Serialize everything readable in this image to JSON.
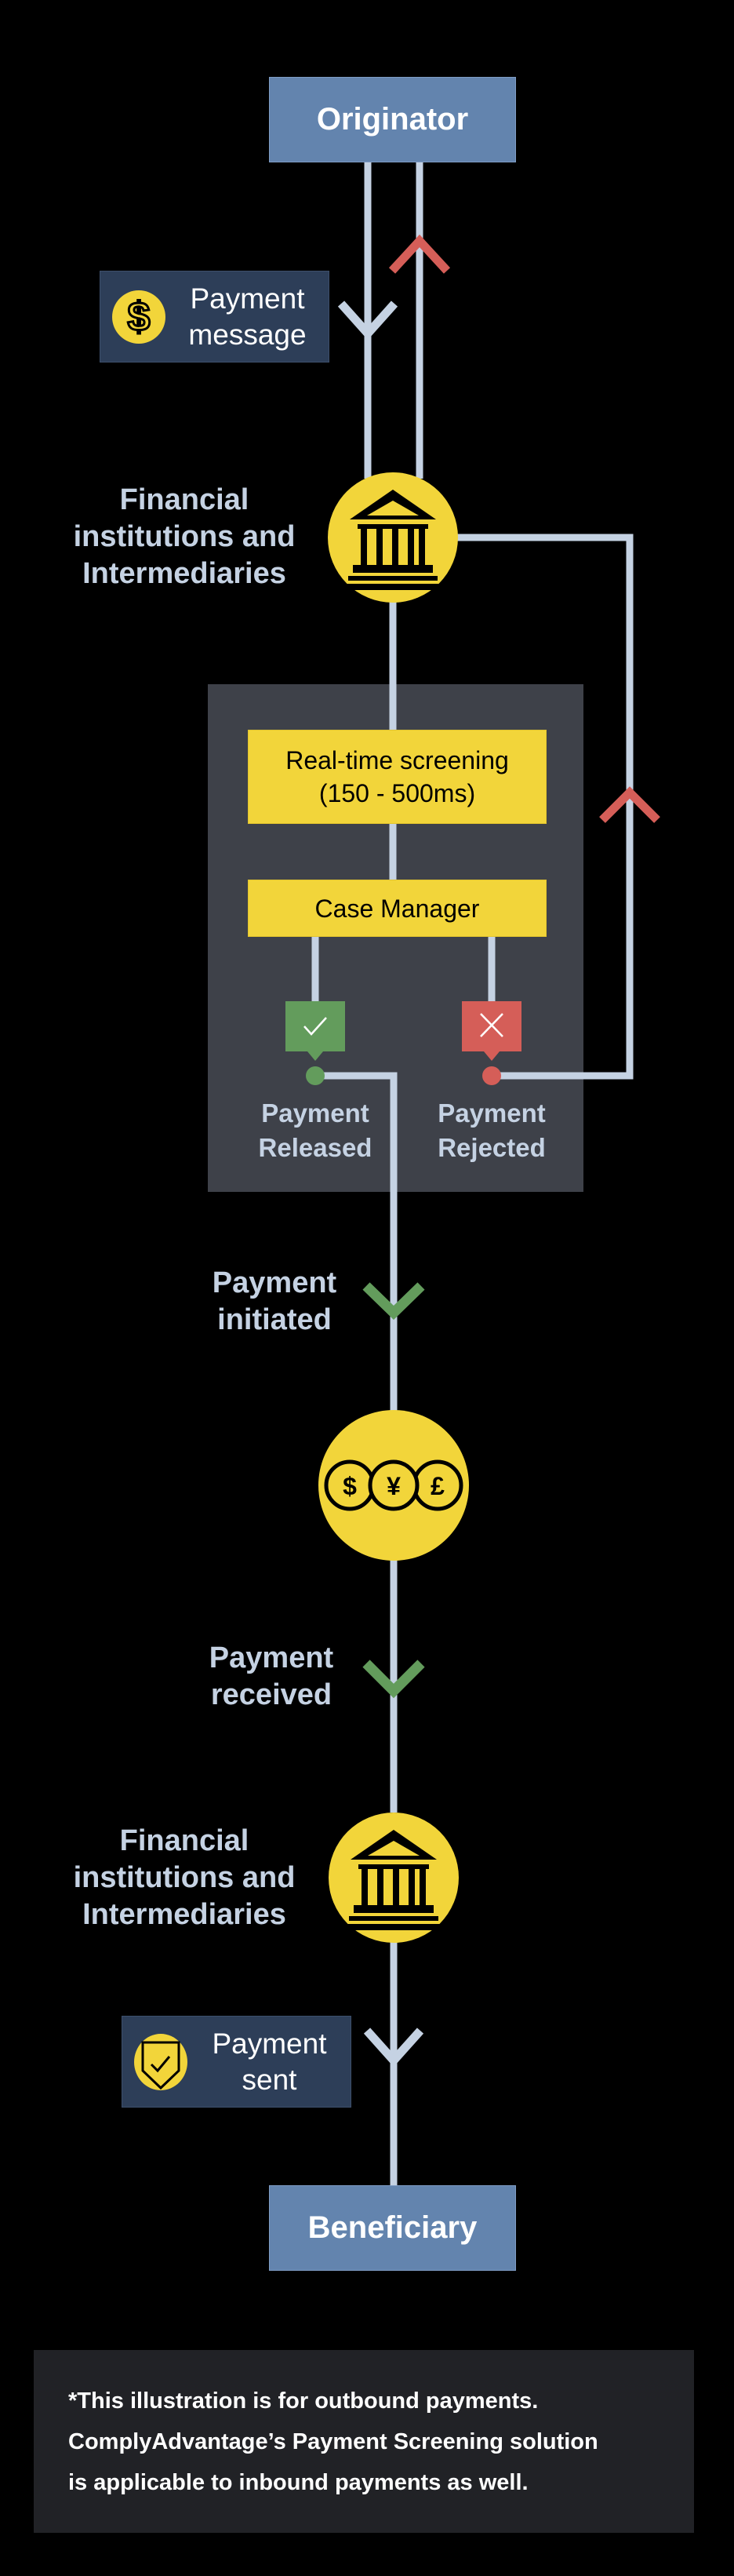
{
  "colors": {
    "background": "#000000",
    "node_blue": "#6384ae",
    "tag_navy": "#2d3e58",
    "line": "#c5d2e3",
    "accent_yellow": "#f2d53a",
    "panel_grey": "#3e4149",
    "approve_green": "#639c5c",
    "reject_red": "#d55e58",
    "footer_bg": "#212226"
  },
  "nodes": {
    "originator": "Originator",
    "beneficiary": "Beneficiary"
  },
  "tags": {
    "payment_message": {
      "icon": "dollar-icon",
      "line1": "Payment",
      "line2": "message"
    },
    "payment_sent": {
      "icon": "shield-check-icon",
      "line1": "Payment",
      "line2": "sent"
    }
  },
  "institutions": [
    {
      "icon": "bank-icon",
      "line1": "Financial",
      "line2": "institutions and",
      "line3": "Intermediaries"
    },
    {
      "icon": "bank-icon",
      "line1": "Financial",
      "line2": "institutions and",
      "line3": "Intermediaries"
    }
  ],
  "screening_panel": {
    "screening": {
      "line1": "Real-time screening",
      "line2": "(150 - 500ms)"
    },
    "case_manager": "Case Manager",
    "released": {
      "icon": "check-icon",
      "line1": "Payment",
      "line2": "Released"
    },
    "rejected": {
      "icon": "x-icon",
      "line1": "Payment",
      "line2": "Rejected"
    }
  },
  "flow_labels": {
    "initiated": {
      "line1": "Payment",
      "line2": "initiated"
    },
    "received": {
      "line1": "Payment",
      "line2": "received"
    }
  },
  "currency": {
    "icon": "currency-coins-icon",
    "symbols": [
      "$",
      "¥",
      "£"
    ]
  },
  "footer": {
    "line1": "*This illustration is for outbound payments.",
    "line2": "ComplyAdvantage’s Payment Screening solution",
    "line3": "is applicable to inbound payments as well."
  }
}
